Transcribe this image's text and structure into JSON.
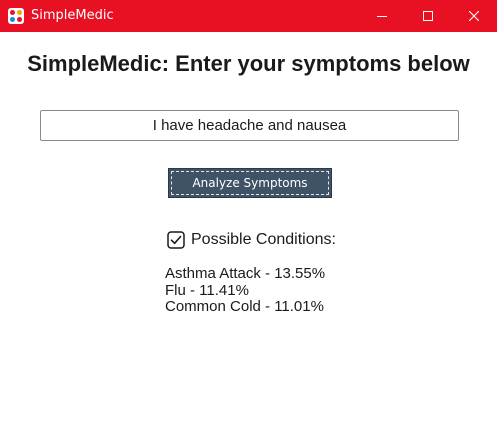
{
  "window": {
    "title": "SimpleMedic",
    "titlebar_color": "#e81123",
    "controls": [
      "minimize-icon",
      "maximize-icon",
      "close-icon"
    ]
  },
  "main": {
    "heading": "SimpleMedic: Enter your symptoms below",
    "symptom_input": {
      "value": "I have headache and nausea",
      "placeholder": ""
    },
    "analyze_button_label": "Analyze Symptoms",
    "analyze_button_color": "#3f5266",
    "conditions_label": "Possible Conditions:",
    "conditions_checked": true,
    "results": [
      {
        "text": "Asthma Attack - 13.55%"
      },
      {
        "text": "Flu - 11.41%"
      },
      {
        "text": "Common Cold - 11.01%"
      }
    ]
  }
}
